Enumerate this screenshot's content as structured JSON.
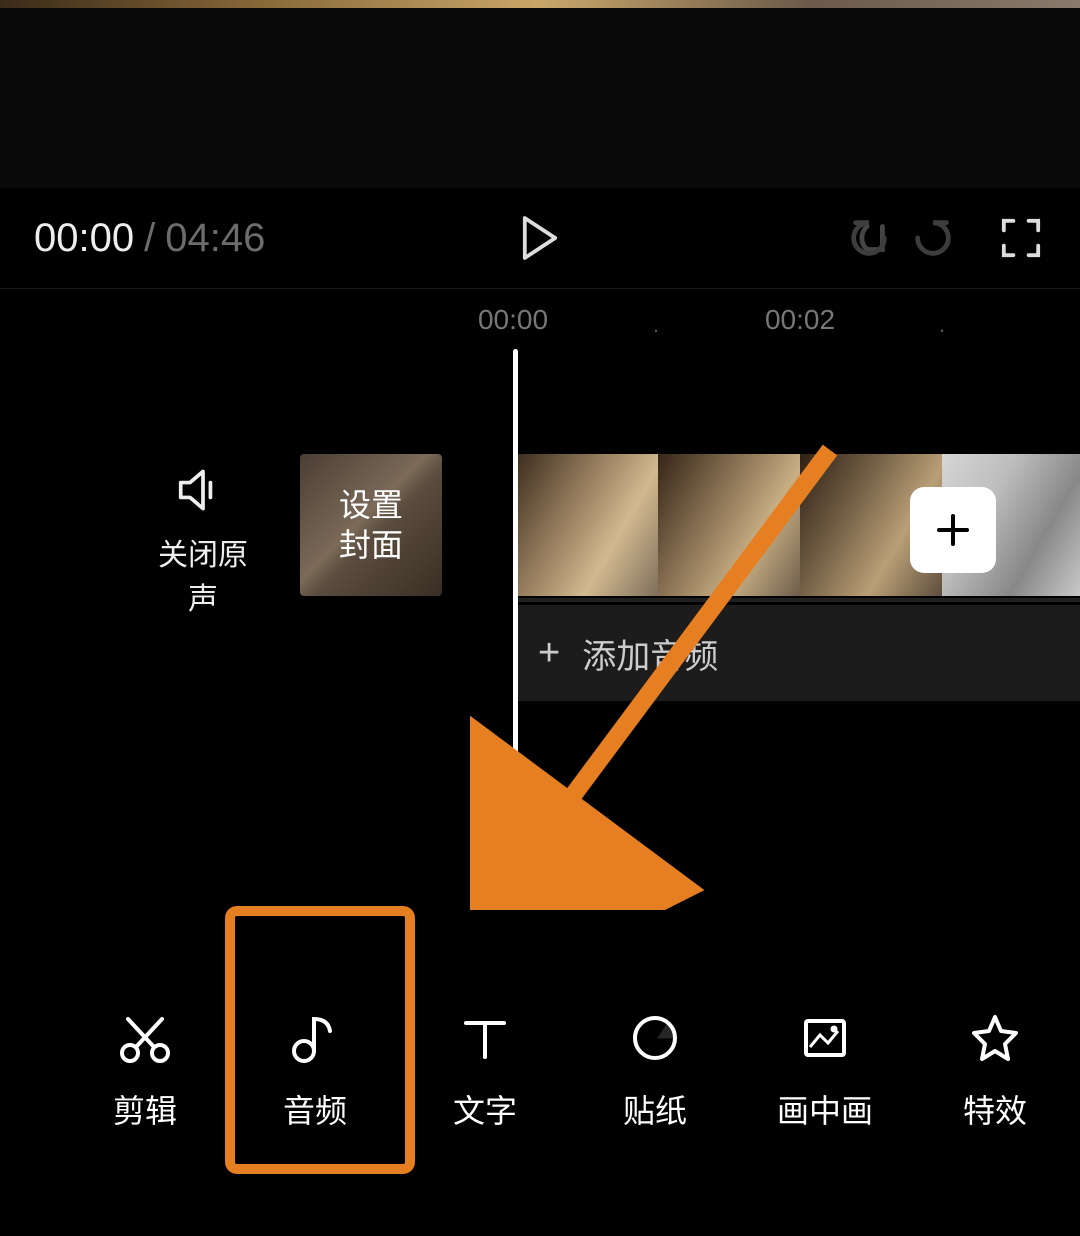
{
  "playback": {
    "current_time": "00:00",
    "separator": "/",
    "total_time": "04:46"
  },
  "ruler": {
    "stamp1": "00:00",
    "dot1": "·",
    "stamp2": "00:02",
    "dot2": "·"
  },
  "timeline": {
    "mute_label": "关闭原声",
    "cover_label": "设置\n封面",
    "add_audio_label": "添加音频"
  },
  "cover_lines": {
    "l1": "设置",
    "l2": "封面"
  },
  "tools": [
    {
      "name": "edit",
      "label": "剪辑"
    },
    {
      "name": "audio",
      "label": "音频"
    },
    {
      "name": "text",
      "label": "文字"
    },
    {
      "name": "sticker",
      "label": "贴纸"
    },
    {
      "name": "pip",
      "label": "画中画"
    },
    {
      "name": "effects",
      "label": "特效"
    }
  ],
  "icons": {
    "play": "play",
    "undo": "undo",
    "redo": "redo",
    "fullscreen": "fullscreen",
    "speaker": "speaker",
    "plus": "+"
  },
  "colors": {
    "highlight": "#e67e22",
    "background": "#000000",
    "secondary_text": "#6c6c6c"
  }
}
